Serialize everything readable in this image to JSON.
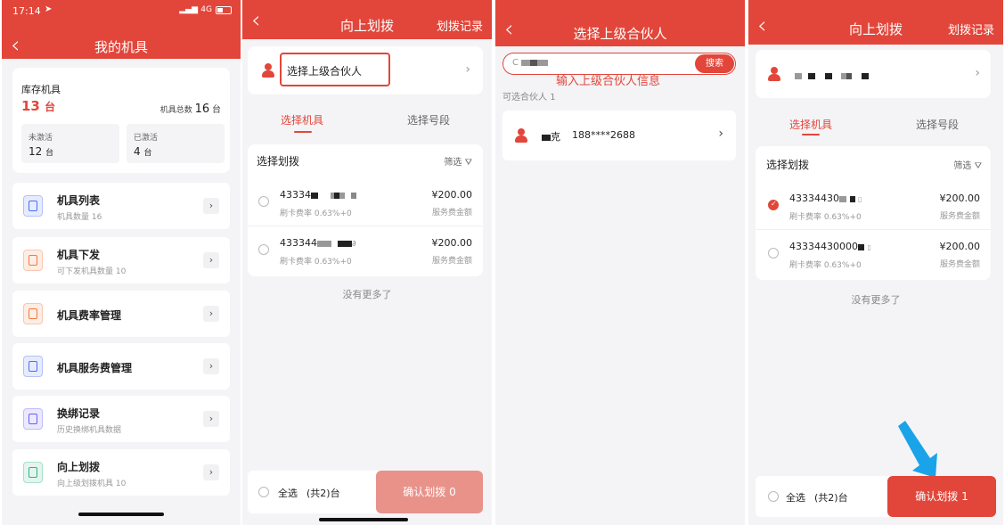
{
  "colors": {
    "accent": "#e2463a",
    "disabled": "#e8928a",
    "background": "#f4f4f6"
  },
  "p1": {
    "status_time": "17:14",
    "signal": "4G",
    "title": "我的机具",
    "stock_label": "库存机具",
    "stock_count": "13",
    "unit": "台",
    "total_label": "机具总数",
    "total_count": "16",
    "inactive_label": "未激活",
    "inactive_count": "12",
    "active_label": "已激活",
    "active_count": "4",
    "menu": [
      {
        "title": "机具列表",
        "sub": "机具数量 16",
        "icon": "list-icon",
        "color": "#4a6cf7"
      },
      {
        "title": "机具下发",
        "sub": "可下发机具数量 10",
        "icon": "download-icon",
        "color": "#f07a3c"
      },
      {
        "title": "机具费率管理",
        "sub": "",
        "icon": "percent-icon",
        "color": "#f07a3c"
      },
      {
        "title": "机具服务费管理",
        "sub": "",
        "icon": "dollar-icon",
        "color": "#4a6cf7"
      },
      {
        "title": "换绑记录",
        "sub": "历史换绑机具数据",
        "icon": "swap-icon",
        "color": "#6a5cf7"
      },
      {
        "title": "向上划拨",
        "sub": "向上级划拨机具 10",
        "icon": "upload-icon",
        "color": "#2cb67d"
      }
    ]
  },
  "p2": {
    "title": "向上划拨",
    "record": "划拨记录",
    "select_partner": "选择上级合伙人",
    "tab1": "选择机具",
    "tab2": "选择号段",
    "section": "选择划拨",
    "filter": "筛选",
    "items": [
      {
        "sn": "43334",
        "rate": "刷卡费率 0.63%+0",
        "price": "¥200.00",
        "svc": "服务费金额"
      },
      {
        "sn": "433344",
        "rate": "刷卡费率 0.63%+0",
        "price": "¥200.00",
        "svc": "服务费金额"
      }
    ],
    "no_more": "没有更多了",
    "select_all": "全选",
    "total": "(共2)台",
    "confirm": "确认划拨 0"
  },
  "p3": {
    "title": "选择上级合伙人",
    "search_btn": "搜索",
    "annotation": "输入上级合伙人信息",
    "available_label": "可选合伙人",
    "available_count": "1",
    "partner_name_suffix": "克",
    "partner_phone": "188****2688"
  },
  "p4": {
    "title": "向上划拨",
    "record": "划拨记录",
    "tab1": "选择机具",
    "tab2": "选择号段",
    "section": "选择划拨",
    "filter": "筛选",
    "items": [
      {
        "sn": "43334430",
        "rate": "刷卡费率 0.63%+0",
        "price": "¥200.00",
        "svc": "服务费金额",
        "checked": true
      },
      {
        "sn": "43334430000",
        "rate": "刷卡费率 0.63%+0",
        "price": "¥200.00",
        "svc": "服务费金额",
        "checked": false
      }
    ],
    "no_more": "没有更多了",
    "select_all": "全选",
    "total": "(共2)台",
    "confirm": "确认划拨 1"
  }
}
